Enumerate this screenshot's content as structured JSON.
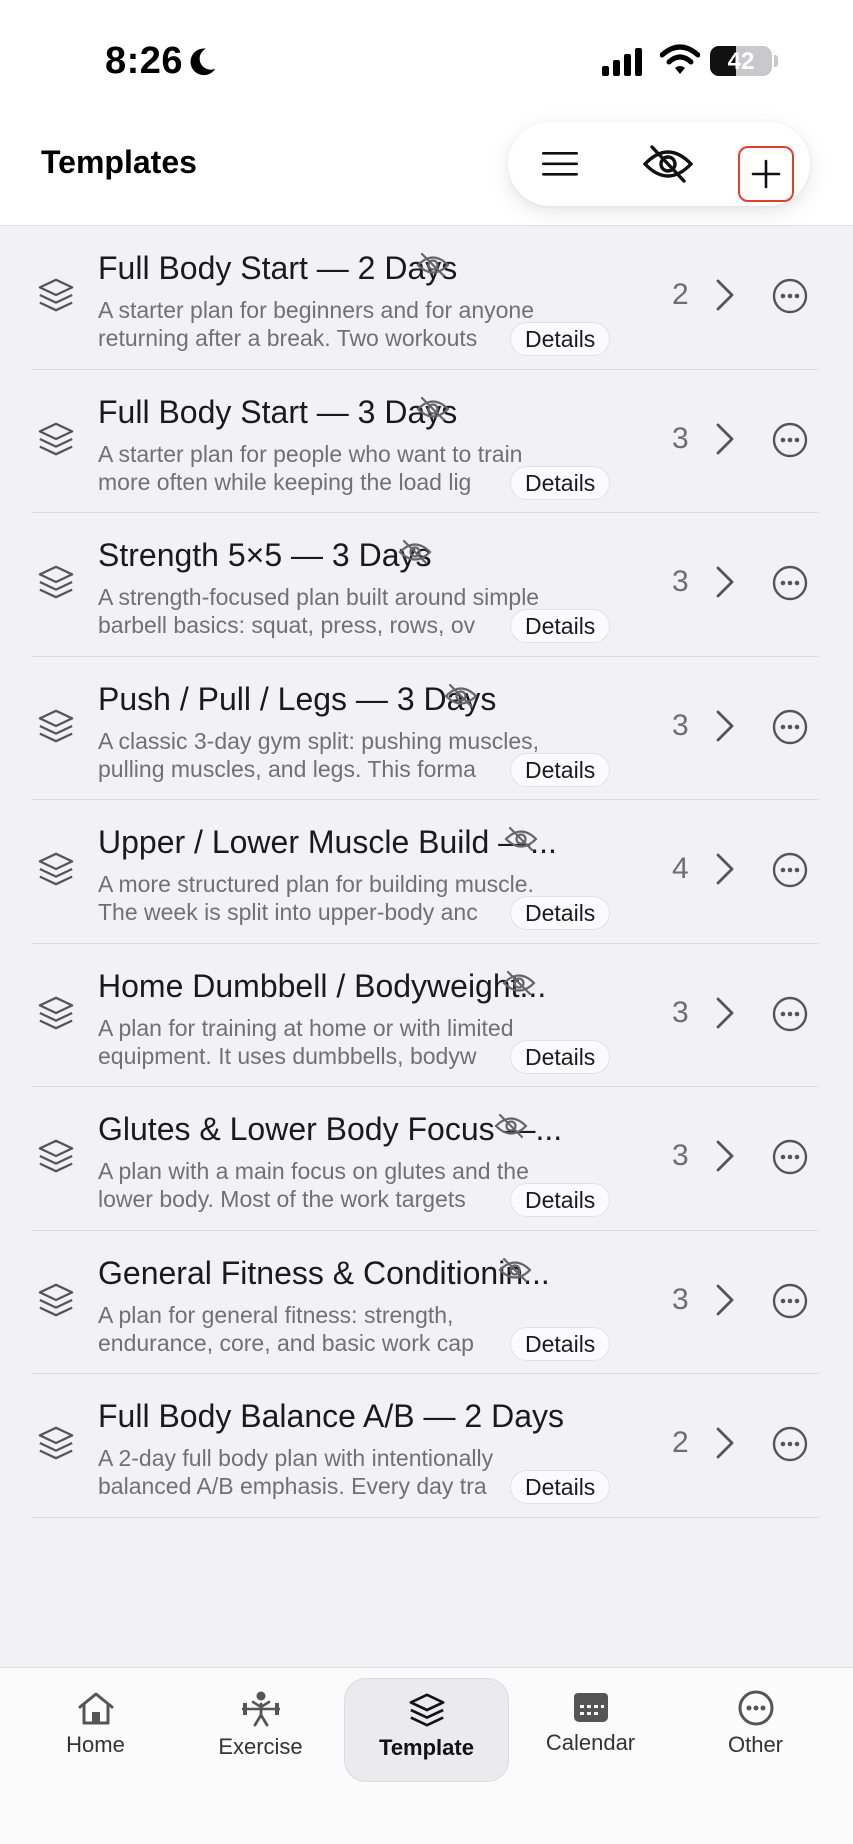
{
  "status": {
    "time": "8:26",
    "battery": "42",
    "battery_level": 0.42
  },
  "header": {
    "title": "Templates"
  },
  "templates": [
    {
      "title": "Full Body Start — 2 Days",
      "desc1": "A starter plan for beginners and for anyone",
      "desc2": "returning after a break. Two workouts",
      "count": "2",
      "details": "Details"
    },
    {
      "title": "Full Body Start — 3 Days",
      "desc1": "A starter plan for people who want to train",
      "desc2": "more often while keeping the load lig",
      "count": "3",
      "details": "Details"
    },
    {
      "title": "Strength 5×5 — 3 Days",
      "desc1": "A strength-focused plan built around simple",
      "desc2": "barbell basics: squat, press, rows, ov",
      "count": "3",
      "details": "Details"
    },
    {
      "title": "Push / Pull / Legs — 3 Days",
      "desc1": "A classic 3-day gym split: pushing muscles,",
      "desc2": "pulling muscles, and legs. This forma",
      "count": "3",
      "details": "Details"
    },
    {
      "title": "Upper / Lower Muscle Build —...",
      "desc1": "A more structured plan for building muscle.",
      "desc2": "The week is split into upper-body anc",
      "count": "4",
      "details": "Details"
    },
    {
      "title": "Home Dumbbell / Bodyweight...",
      "desc1": "A plan for training at home or with limited",
      "desc2": "equipment. It uses dumbbells, bodyw",
      "count": "3",
      "details": "Details"
    },
    {
      "title": "Glutes & Lower Body Focus —...",
      "desc1": "A plan with a main focus on glutes and the",
      "desc2": "lower body. Most of the work targets",
      "count": "3",
      "details": "Details"
    },
    {
      "title": "General Fitness & Conditionin...",
      "desc1": "A plan for general fitness: strength,",
      "desc2": "endurance, core, and basic work cap",
      "count": "3",
      "details": "Details"
    },
    {
      "title": "Full Body Balance A/B — 2 Days",
      "desc1": "A 2-day full body plan with intentionally",
      "desc2": "balanced A/B emphasis. Every day tra",
      "count": "2",
      "details": "Details"
    }
  ],
  "tabs": [
    {
      "label": "Home",
      "icon": "home-icon"
    },
    {
      "label": "Exercise",
      "icon": "exercise-icon"
    },
    {
      "label": "Template",
      "icon": "layers-icon",
      "active": true
    },
    {
      "label": "Calendar",
      "icon": "calendar-icon"
    },
    {
      "label": "Other",
      "icon": "more-icon"
    }
  ],
  "colors": {
    "accent_outline": "#e0402a",
    "background": "#f2f2f6"
  }
}
